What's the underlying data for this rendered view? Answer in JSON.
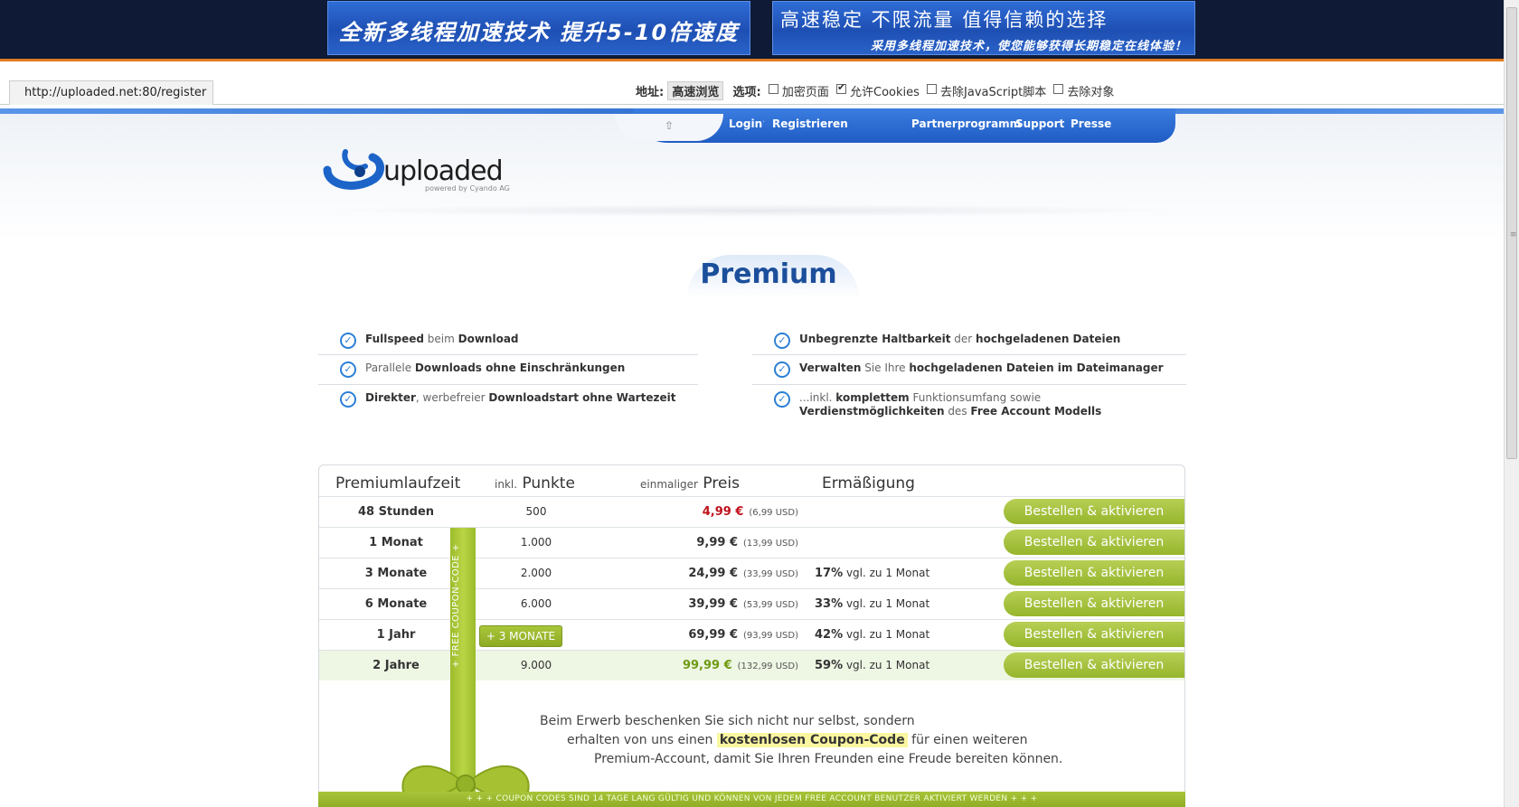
{
  "ads": {
    "left": {
      "text": "全新多线程加速技术  提升5-10倍速度"
    },
    "right": {
      "line1": "高速稳定  不限流量  值得信赖的选择",
      "line2": "采用多线程加速技术，使您能够获得长期稳定在线体验！"
    }
  },
  "proxy": {
    "url": "http://uploaded.net:80/register",
    "address_label": "地址:",
    "fast_browse": "高速浏览",
    "options_label": "选项:",
    "options": [
      {
        "label": "加密页面",
        "checked": false
      },
      {
        "label": "允许Cookies",
        "checked": true
      },
      {
        "label": "去除JavaScript脚本",
        "checked": false
      },
      {
        "label": "去除对象",
        "checked": false
      }
    ]
  },
  "nav": {
    "login": "Login",
    "register": "Registrieren",
    "partner": "Partnerprogramm",
    "support": "Support",
    "press": "Presse",
    "sep": "·"
  },
  "logo": {
    "word": "uploaded",
    "sub": "powered by Cyando AG"
  },
  "title": "Premium",
  "features_left": [
    {
      "b1": "Fullspeed",
      "t1": " beim ",
      "b2": "Download",
      "t2": ""
    },
    {
      "b1": "",
      "t1": "Parallele ",
      "b2": "Downloads ohne Einschränkungen",
      "t2": ""
    },
    {
      "b1": "Direkter",
      "t1": ", werbefreier ",
      "b2": "Downloadstart ohne Wartezeit",
      "t2": ""
    }
  ],
  "features_right": [
    {
      "b1": "Unbegrenzte Haltbarkeit",
      "t1": " der ",
      "b2": "hochgeladenen Dateien",
      "t2": ""
    },
    {
      "b1": "Verwalten",
      "t1": " Sie Ihre ",
      "b2": "hochgeladenen Dateien im Dateimanager",
      "t2": ""
    },
    {
      "b1": "",
      "t1": "...inkl. ",
      "b2": "komplettem",
      "t2": " Funktionsumfang sowie ",
      "b3": "Verdienstmöglichkeiten",
      "t3": " des ",
      "b4": "Free Account Modells"
    }
  ],
  "table": {
    "headers": {
      "duration": "Premiumlaufzeit",
      "points_small": "inkl.",
      "points": "Punkte",
      "price_small": "einmaliger",
      "price": "Preis",
      "discount": "Ermäßigung"
    },
    "button_label": "Bestellen & aktivieren",
    "rows": [
      {
        "duration": "48 Stunden",
        "points": "500",
        "price": "4,99 €",
        "usd": "(6,99 USD)",
        "discount_pct": "",
        "discount_txt": "",
        "price_color": "#c0121b"
      },
      {
        "duration": "1 Monat",
        "points": "1.000",
        "price": "9,99 €",
        "usd": "(13,99 USD)",
        "discount_pct": "",
        "discount_txt": "",
        "price_color": "#333333"
      },
      {
        "duration": "3 Monate",
        "points": "2.000",
        "price": "24,99 €",
        "usd": "(33,99 USD)",
        "discount_pct": "17%",
        "discount_txt": " vgl. zu 1 Monat",
        "price_color": "#333333"
      },
      {
        "duration": "6 Monate",
        "points": "6.000",
        "price": "39,99 €",
        "usd": "(53,99 USD)",
        "discount_pct": "33%",
        "discount_txt": " vgl. zu 1 Monat",
        "price_color": "#333333"
      },
      {
        "duration": "1 Jahr",
        "points": "",
        "price": "69,99 €",
        "usd": "(93,99 USD)",
        "discount_pct": "42%",
        "discount_txt": " vgl. zu 1 Monat",
        "price_color": "#333333"
      },
      {
        "duration": "2 Jahre",
        "points": "9.000",
        "price": "99,99 €",
        "usd": "(132,99 USD)",
        "discount_pct": "59%",
        "discount_txt": " vgl. zu 1 Monat",
        "price_color": "#6f9a12"
      }
    ]
  },
  "coupon": {
    "ribbon": "+ FREE COUPON-CODE +",
    "tag": "+ 3 MONATE",
    "line1": "Beim Erwerb beschenken Sie sich nicht nur selbst, sondern",
    "line2_pre": "erhalten von uns einen ",
    "line2_hl": "kostenlosen Coupon-Code",
    "line2_post": " für einen weiteren",
    "line3": "Premium-Account, damit Sie Ihren Freunden eine Freude bereiten können.",
    "footer": "+ + +  COUPON CODES SIND 14 TAGE LANG GÜLTIG UND KÖNNEN VON JEDEM FREE ACCOUNT BENUTZER AKTIVIERT WERDEN  + + +"
  },
  "colors": {
    "accent": "#2f6fcf",
    "green": "#9cbb2c",
    "banner_bg": "#0e1a36"
  }
}
